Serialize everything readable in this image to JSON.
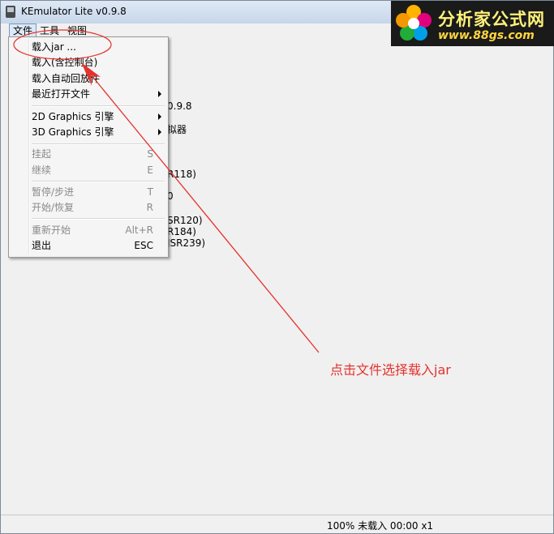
{
  "window": {
    "title": "KEmulator Lite v0.9.8"
  },
  "menubar": {
    "items": [
      "文件",
      "工具",
      "视图"
    ]
  },
  "file_menu": {
    "load_jar": "载入jar ...",
    "load_with_console": "载入(含控制台)",
    "load_auto_playback": "载入自动回放件",
    "recent_files": "最近打开文件",
    "graphics_2d": "2D Graphics 引擎",
    "graphics_3d": "3D Graphics 引擎",
    "suspend": "挂起",
    "suspend_shortcut": "S",
    "resume": "继续",
    "resume_shortcut": "E",
    "pause_step": "暂停/步进",
    "pause_step_shortcut": "T",
    "start_restore": "开始/恢复",
    "start_restore_shortcut": "R",
    "restart": "重新开始",
    "restart_shortcut": "Alt+R",
    "exit": "退出",
    "exit_shortcut": "ESC"
  },
  "background_text": {
    "version": "0.9.8",
    "emulator": "拟器",
    "jsr118": "R118)",
    "zero": "0",
    "jsr120": "SR120)",
    "jsr184": "R184)",
    "jsr239": "JSR239)"
  },
  "status": {
    "text": "100% 未载入 00:00 x1"
  },
  "annotation": {
    "text": "点击文件选择载入jar",
    "color": "#e5322d"
  },
  "logo": {
    "name": "分析家公式网",
    "url": "www.88gs.com"
  },
  "colors": {
    "accent": "#e5322d",
    "menu_highlight": "#dce8f7",
    "disabled": "#8a8a8a"
  }
}
